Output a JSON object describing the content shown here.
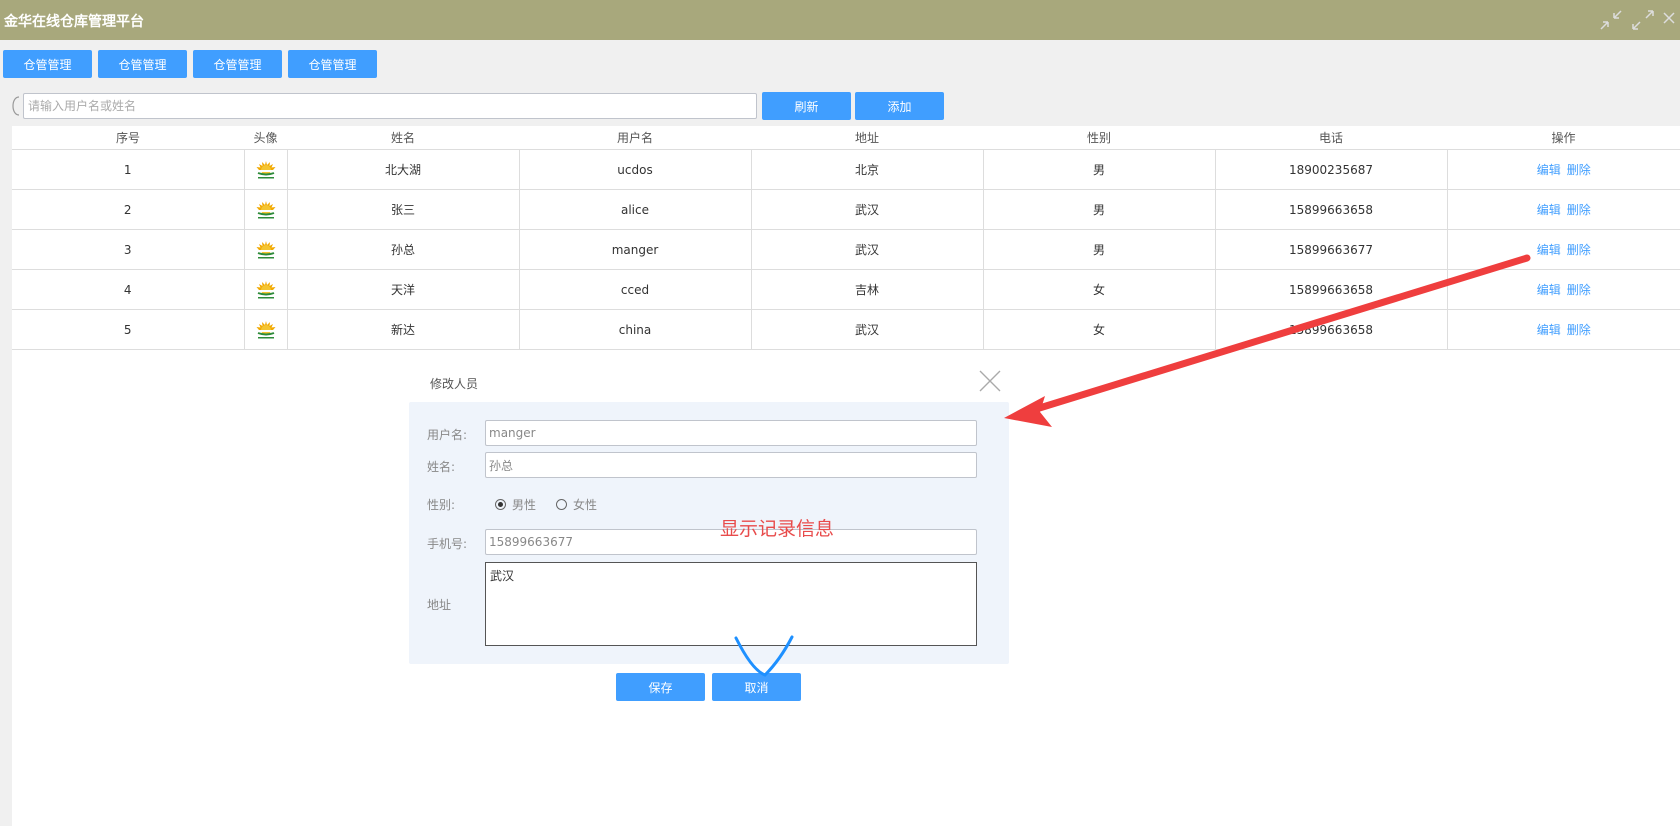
{
  "app": {
    "title": "金华在线仓库管理平台"
  },
  "nav": {
    "tabs": [
      "仓管管理",
      "仓管管理",
      "仓管管理",
      "仓管管理"
    ]
  },
  "toolbar": {
    "search_placeholder": "请输入用户名或姓名",
    "refresh_label": "刷新",
    "add_label": "添加"
  },
  "table": {
    "headers": [
      "序号",
      "头像",
      "姓名",
      "用户名",
      "地址",
      "性别",
      "电话",
      "操作"
    ],
    "rows": [
      {
        "index": "1",
        "name": "北大湖",
        "username": "ucdos",
        "address": "北京",
        "gender": "男",
        "phone": "18900235687"
      },
      {
        "index": "2",
        "name": "张三",
        "username": "alice",
        "address": "武汉",
        "gender": "男",
        "phone": "15899663658"
      },
      {
        "index": "3",
        "name": "孙总",
        "username": "manger",
        "address": "武汉",
        "gender": "男",
        "phone": "15899663677"
      },
      {
        "index": "4",
        "name": "天洋",
        "username": "cced",
        "address": "吉林",
        "gender": "女",
        "phone": "15899663658"
      },
      {
        "index": "5",
        "name": "新达",
        "username": "china",
        "address": "武汉",
        "gender": "女",
        "phone": "15899663658"
      }
    ],
    "edit_label": "编辑",
    "delete_label": "删除"
  },
  "dialog": {
    "title": "修改人员",
    "username_label": "用户名:",
    "username_value": "manger",
    "name_label": "姓名:",
    "name_value": "孙总",
    "gender_label": "性别:",
    "gender_male": "男性",
    "gender_female": "女性",
    "gender_selected": "male",
    "phone_label": "手机号:",
    "phone_value": "15899663677",
    "address_label": "地址",
    "address_value": "武汉",
    "save_label": "保存",
    "cancel_label": "取消"
  },
  "annotation": {
    "text": "显示记录信息",
    "arrow_color": "#ef3e3e",
    "check_color": "#1e90ff"
  },
  "colors": {
    "titlebar": "#a8a87c",
    "primary": "#409eff",
    "dialog_bg": "#eff4fb"
  }
}
